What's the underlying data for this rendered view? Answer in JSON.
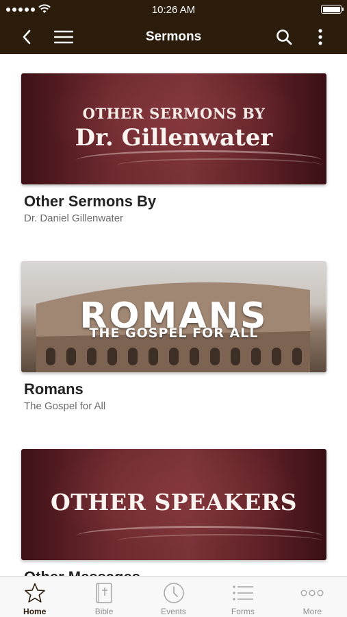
{
  "status_bar": {
    "time": "10:26 AM"
  },
  "navbar": {
    "title": "Sermons"
  },
  "cards": [
    {
      "banner_line1": "OTHER SERMONS BY",
      "banner_line2": "Dr. Gillenwater",
      "title": "Other Sermons By",
      "subtitle": "Dr. Daniel Gillenwater"
    },
    {
      "banner_line1": "ROMANS",
      "banner_line2": "THE GOSPEL FOR ALL",
      "title": "Romans",
      "subtitle": "The Gospel for All"
    },
    {
      "banner_line1": "OTHER SPEAKERS",
      "title": "Other Messages"
    }
  ],
  "tabbar": {
    "items": [
      {
        "label": "Home",
        "icon": "star-icon",
        "active": true
      },
      {
        "label": "Bible",
        "icon": "bible-icon",
        "active": false
      },
      {
        "label": "Events",
        "icon": "clock-icon",
        "active": false
      },
      {
        "label": "Forms",
        "icon": "list-icon",
        "active": false
      },
      {
        "label": "More",
        "icon": "more-dots-icon",
        "active": false
      }
    ]
  },
  "colors": {
    "header_bg": "#2b1c0c",
    "banner_maroon": "#6e2a30",
    "active_tab": "#2b1c0c"
  }
}
